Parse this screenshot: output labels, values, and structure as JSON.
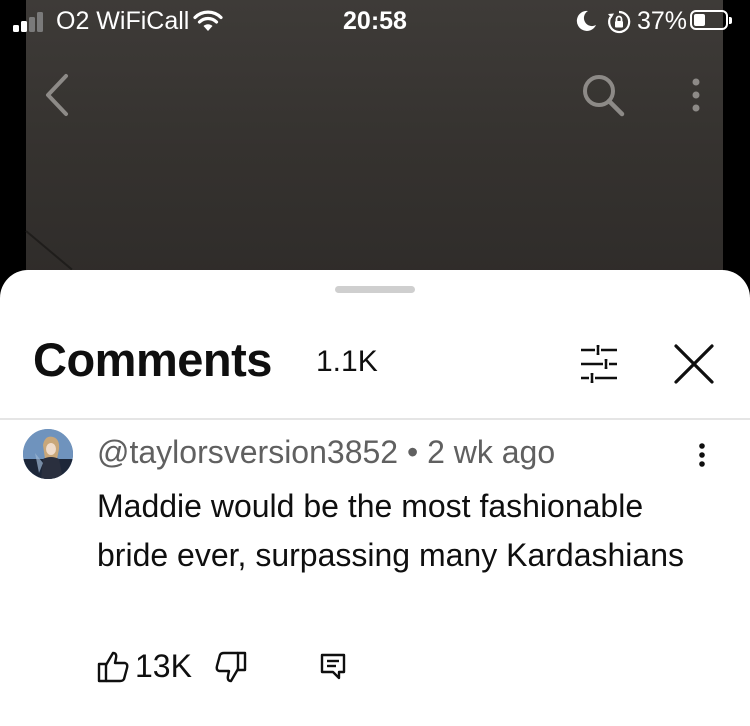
{
  "status_bar": {
    "carrier": "O2 WiFiCall",
    "time": "20:58",
    "battery_percent": "37%",
    "battery_level": 0.37,
    "icons": [
      "signal-icon",
      "wifi-icon",
      "moon-icon",
      "rotation-lock-icon",
      "battery-icon"
    ]
  },
  "player": {
    "icons": [
      "back-icon",
      "search-icon",
      "more-vertical-icon"
    ]
  },
  "comments_panel": {
    "title": "Comments",
    "count": "1.1K",
    "icons": [
      "filter-icon",
      "close-icon"
    ]
  },
  "comments": [
    {
      "author": "@taylorsversion3852",
      "separator": "•",
      "age": "2 wk ago",
      "text": "Maddie would be the most fashionable bride ever, surpassing many Kardashians",
      "likes": "13K",
      "icons": [
        "thumbs-up-icon",
        "thumbs-down-icon",
        "reply-icon",
        "more-vertical-icon"
      ]
    }
  ],
  "colors": {
    "sheet_background": "#ffffff",
    "primary_text": "#0f0f0f",
    "secondary_text": "#606060",
    "video_background": "#3a3734"
  }
}
